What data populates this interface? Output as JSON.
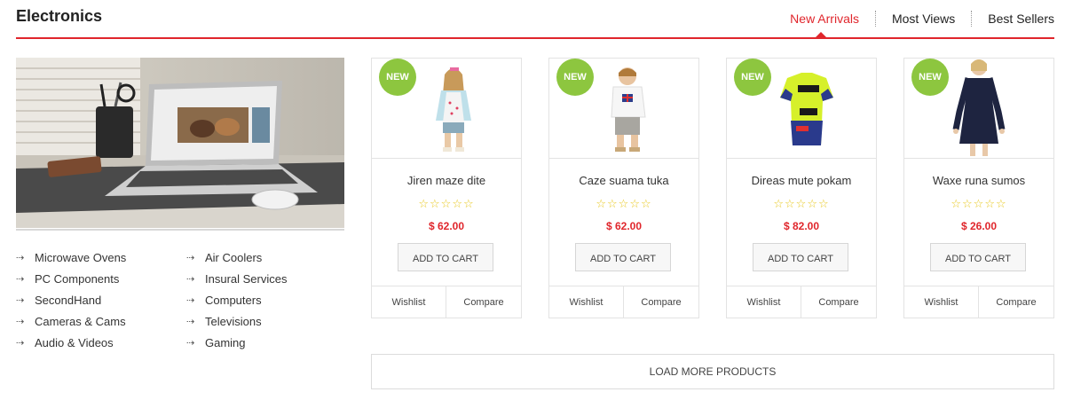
{
  "section": {
    "title": "Electronics"
  },
  "tabs": [
    {
      "label": "New Arrivals"
    },
    {
      "label": "Most Views"
    },
    {
      "label": "Best Sellers"
    }
  ],
  "categories": [
    "Microwave Ovens",
    "Air Coolers",
    "PC Components",
    "Insural Services",
    "SecondHand",
    "Computers",
    "Cameras & Cams",
    "Televisions",
    "Audio & Videos",
    "Gaming"
  ],
  "products": [
    {
      "badge": "NEW",
      "name": "Jiren maze dite",
      "rating": 0,
      "price": "$ 62.00",
      "cart": "ADD TO CART",
      "wishlist": "Wishlist",
      "compare": "Compare"
    },
    {
      "badge": "NEW",
      "name": "Caze suama tuka",
      "rating": 0,
      "price": "$ 62.00",
      "cart": "ADD TO CART",
      "wishlist": "Wishlist",
      "compare": "Compare"
    },
    {
      "badge": "NEW",
      "name": "Direas mute pokam",
      "rating": 0,
      "price": "$ 82.00",
      "cart": "ADD TO CART",
      "wishlist": "Wishlist",
      "compare": "Compare"
    },
    {
      "badge": "NEW",
      "name": "Waxe runa sumos",
      "rating": 0,
      "price": "$ 26.00",
      "cart": "ADD TO CART",
      "wishlist": "Wishlist",
      "compare": "Compare"
    }
  ],
  "load_more": "LOAD MORE PRODUCTS",
  "colors": {
    "accent": "#e0262c",
    "badge": "#8dc63f",
    "star": "#e8c820"
  }
}
